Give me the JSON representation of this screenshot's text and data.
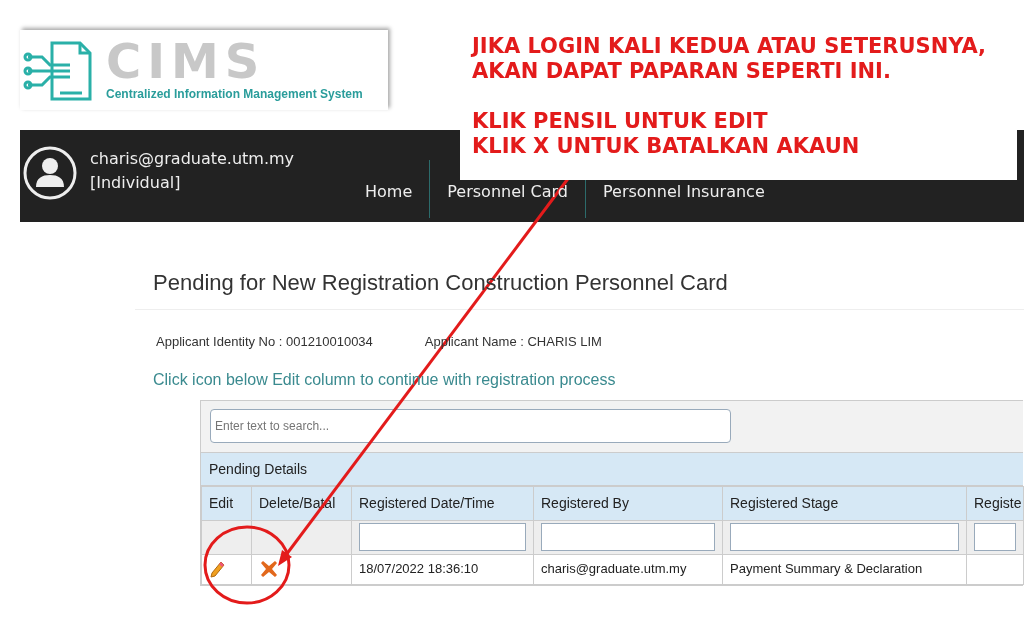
{
  "logo": {
    "wordmark": "CIMS",
    "tagline": "Centralized Information Management System"
  },
  "user": {
    "email": "charis@graduate.utm.my",
    "role": "[Individual]"
  },
  "nav": [
    {
      "label": "Home"
    },
    {
      "label": "Personnel Card"
    },
    {
      "label": "Personnel Insurance"
    }
  ],
  "annotation": {
    "paragraphs": [
      [
        "JIKA LOGIN KALI KEDUA ATAU SETERUSNYA,",
        "AKAN DAPAT PAPARAN SEPERTI INI."
      ],
      [
        "KLIK PENSIL UNTUK EDIT",
        "KLIK X UNTUK BATALKAN AKAUN"
      ]
    ]
  },
  "page_title": "Pending for New Registration Construction Personnel Card",
  "applicant": [
    {
      "text": "Applicant Identity No : 001210010034"
    },
    {
      "text": "Applicant Name : CHARIS LIM"
    }
  ],
  "instruction": "Click icon below Edit column to continue with registration process",
  "table": {
    "search": {
      "placeholder": "Enter text to search..."
    },
    "group_title": "Pending Details",
    "columns": [
      "Edit",
      "Delete/Batal",
      "Registered Date/Time",
      "Registered By",
      "Registered Stage",
      "Registe"
    ],
    "filters": [
      false,
      false,
      true,
      true,
      true,
      true
    ],
    "rows": [
      {
        "cells": [
          "",
          "",
          "18/07/2022 18:36:10",
          "charis@graduate.utm.my",
          "Payment Summary & Declaration",
          ""
        ]
      }
    ]
  }
}
